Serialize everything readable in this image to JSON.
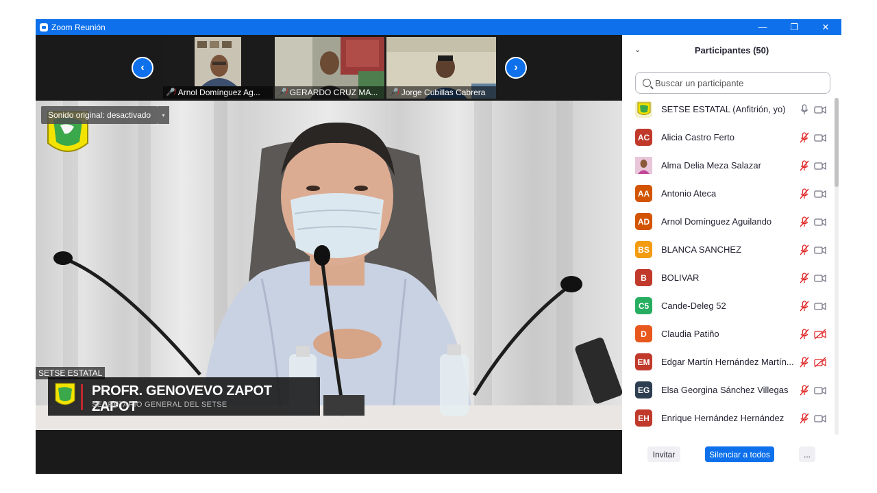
{
  "window": {
    "title": "Zoom Reunión",
    "minimize": "—",
    "restore": "❐",
    "close": "✕"
  },
  "thumbnails": [
    {
      "name": "Arnol Domínguez Ag..."
    },
    {
      "name": "GERARDO CRUZ MA..."
    },
    {
      "name": "Jorge Cubillas Cabrera"
    }
  ],
  "nav": {
    "prev": "‹",
    "next": "›"
  },
  "main_video": {
    "sound_badge": "Sonido original: desactivado",
    "sound_dropdown": "▾",
    "speaker_name": "PROFR. GENOVEVO ZAPOT ZAPOT",
    "speaker_role": "SECRETARIO GENERAL DEL SETSE",
    "active_label": "SETSE ESTATAL"
  },
  "panel": {
    "title": "Participantes (50)",
    "collapse": "⌄",
    "search_placeholder": "Buscar un participante",
    "participants": [
      {
        "name": "SETSE ESTATAL (Anfitrión, yo)",
        "initials": "",
        "color": "#d8d020",
        "logo": true,
        "mic": "on",
        "cam": "off"
      },
      {
        "name": "Alicia Castro Ferto",
        "initials": "AC",
        "color": "#c0392b",
        "mic": "muted",
        "cam": "off"
      },
      {
        "name": "Alma Delia Meza Salazar",
        "initials": "",
        "color": "#c2459a",
        "photo": true,
        "mic": "muted",
        "cam": "off"
      },
      {
        "name": "Antonio Ateca",
        "initials": "AA",
        "color": "#d35400",
        "mic": "muted",
        "cam": "off"
      },
      {
        "name": "Arnol Domínguez Aguilando",
        "initials": "AD",
        "color": "#d35400",
        "mic": "muted",
        "cam": "off"
      },
      {
        "name": "BLANCA SANCHEZ",
        "initials": "BS",
        "color": "#f39c12",
        "mic": "muted",
        "cam": "off"
      },
      {
        "name": "BOLIVAR",
        "initials": "B",
        "color": "#c0392b",
        "mic": "muted",
        "cam": "off"
      },
      {
        "name": "Cande-Deleg 52",
        "initials": "C5",
        "color": "#27ae60",
        "mic": "muted",
        "cam": "off"
      },
      {
        "name": "Claudia Patiño",
        "initials": "D",
        "color": "#e8571c",
        "mic": "muted",
        "cam": "muted"
      },
      {
        "name": "Edgar Martín Hernández Martín...",
        "initials": "EM",
        "color": "#c0392b",
        "mic": "muted",
        "cam": "muted"
      },
      {
        "name": "Elsa Georgina Sánchez Villegas",
        "initials": "EG",
        "color": "#2c3e50",
        "mic": "muted",
        "cam": "off"
      },
      {
        "name": "Enrique Hernández Hernández",
        "initials": "EH",
        "color": "#c0392b",
        "mic": "muted",
        "cam": "off"
      }
    ],
    "footer": {
      "invite": "Invitar",
      "mute_all": "Silenciar a todos",
      "more": "..."
    }
  }
}
